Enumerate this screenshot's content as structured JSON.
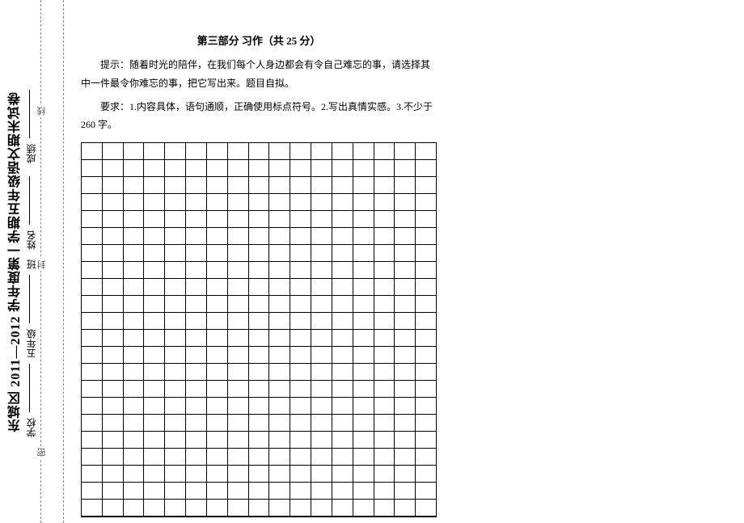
{
  "sidebar": {
    "title": "东城区 2011—2012 学年度第一学期五年级语文期末试卷",
    "fields": {
      "school_label": "学校",
      "grade_label": "五年级",
      "class_label": "班",
      "name_label": "姓名",
      "score_label": "成绩"
    },
    "fold_markers": {
      "mi": "密",
      "feng": "封",
      "xian": "线"
    }
  },
  "content": {
    "section_title": "第三部分  习作（共 25 分）",
    "prompt": "提示：随着时光的陪伴，在我们每个人身边都会有令自己难忘的事，请选择其中一件最令你难忘的事，把它写出来。题目自拟。",
    "requirements": "要求：1.内容具体，语句通顺，正确使用标点符号。2.写出真情实感。3.不少于 260 字。"
  },
  "grid": {
    "rows": 22,
    "cols": 17
  }
}
